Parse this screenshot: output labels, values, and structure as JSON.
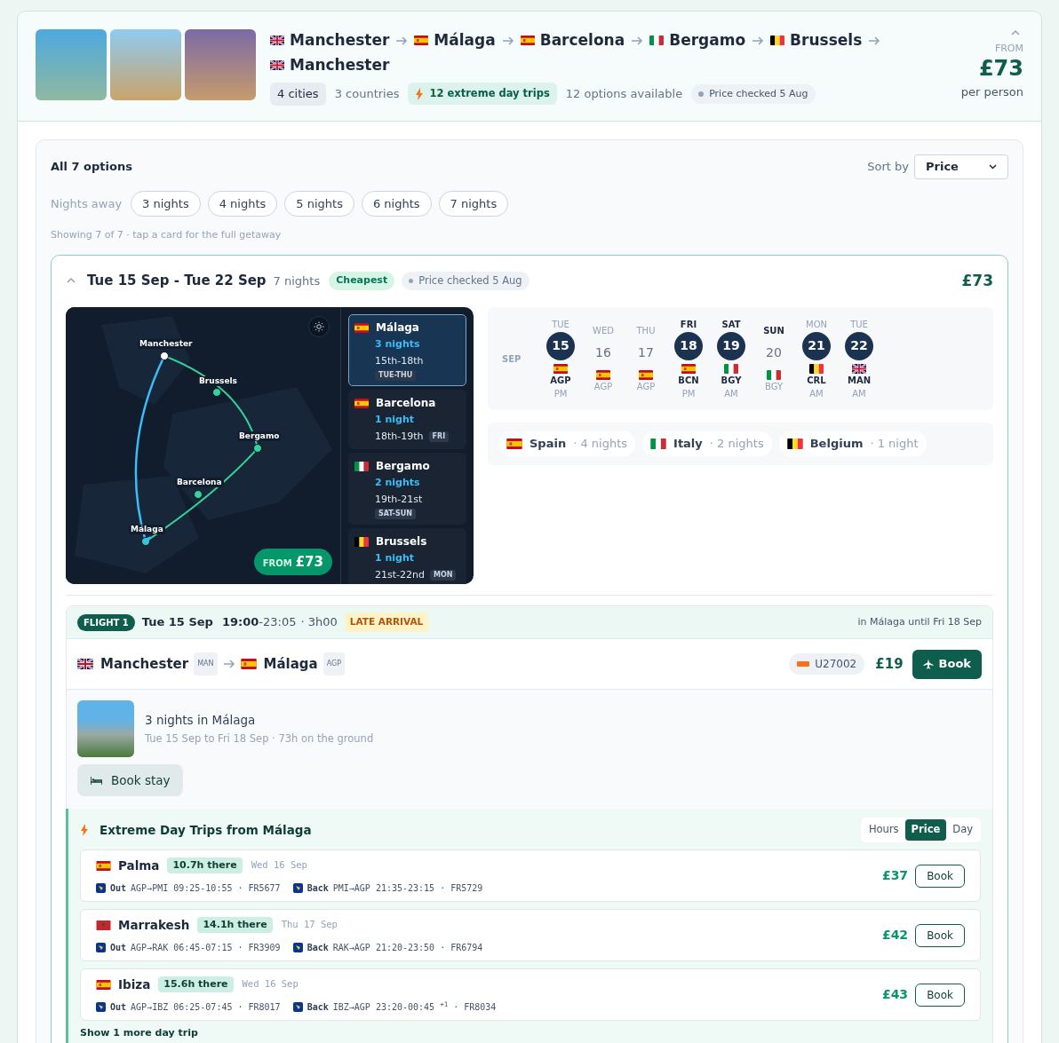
{
  "trip": {
    "route": [
      {
        "city": "Manchester",
        "kind": "gb"
      },
      {
        "city": "Málaga",
        "kind": "es"
      },
      {
        "city": "Barcelona",
        "kind": "es"
      },
      {
        "city": "Bergamo",
        "kind": "it"
      },
      {
        "city": "Brussels",
        "kind": "be"
      },
      {
        "city": "Manchester",
        "kind": "gb"
      }
    ],
    "cities": "4 cities",
    "countries": "3 countries",
    "day_trips": "12 extreme day trips",
    "options": "12 options available",
    "price_checked": "Price checked 5 Aug",
    "from_label": "FROM",
    "price": "£73",
    "per_person": "per person"
  },
  "panel": {
    "title": "All 7 options",
    "sort_label": "Sort by",
    "sort_value": "Price",
    "nights_label": "Nights away",
    "nights_filters": [
      {
        "label": "3 nights",
        "selected": false
      },
      {
        "label": "4 nights",
        "selected": false
      },
      {
        "label": "5 nights",
        "selected": false
      },
      {
        "label": "6 nights",
        "selected": false
      },
      {
        "label": "7 nights",
        "selected": false
      }
    ],
    "showing": "Showing 7 of 7 · tap a card for the full getaway"
  },
  "option": {
    "dates": "Tue 15 Sep - Tue 22 Sep",
    "nights": "7 nights",
    "badge": "Cheapest",
    "price_checked": "Price checked 5 Aug",
    "price": "£73",
    "map": {
      "labels": [
        "Manchester",
        "Brussels",
        "Bergamo",
        "Barcelona",
        "Málaga"
      ],
      "from_label": "FROM",
      "price": "£73"
    },
    "stops": [
      {
        "city": "Málaga",
        "kind": "es",
        "nights": "3 nights",
        "dates": "15th-18th",
        "days": "TUE-THU",
        "selected": true
      },
      {
        "city": "Barcelona",
        "kind": "es",
        "nights": "1 night",
        "dates": "18th-19th",
        "days": "FRI",
        "selected": false
      },
      {
        "city": "Bergamo",
        "kind": "it",
        "nights": "2 nights",
        "dates": "19th-21st",
        "days": "SAT-SUN",
        "selected": false
      },
      {
        "city": "Brussels",
        "kind": "be",
        "nights": "1 night",
        "dates": "21st-22nd",
        "days": "MON",
        "selected": false
      }
    ],
    "calendar": {
      "month": "SEP",
      "days": [
        {
          "dow": "TUE",
          "day": "15",
          "kind": "es",
          "code": "AGP",
          "time": "PM",
          "flight": true,
          "weekend": false
        },
        {
          "dow": "WED",
          "day": "16",
          "kind": "es",
          "code": "AGP",
          "flight": false,
          "weekend": false
        },
        {
          "dow": "THU",
          "day": "17",
          "kind": "es",
          "code": "AGP",
          "flight": false,
          "weekend": false
        },
        {
          "dow": "FRI",
          "day": "18",
          "kind": "es",
          "code": "BCN",
          "time": "PM",
          "flight": true,
          "weekend": true
        },
        {
          "dow": "SAT",
          "day": "19",
          "kind": "it",
          "code": "BGY",
          "time": "AM",
          "flight": true,
          "weekend": true
        },
        {
          "dow": "SUN",
          "day": "20",
          "kind": "it",
          "code": "BGY",
          "flight": false,
          "weekend": true
        },
        {
          "dow": "MON",
          "day": "21",
          "kind": "be",
          "code": "CRL",
          "time": "AM",
          "flight": true,
          "weekend": false
        },
        {
          "dow": "TUE",
          "day": "22",
          "kind": "gb",
          "code": "MAN",
          "time": "AM",
          "flight": true,
          "weekend": false
        }
      ]
    },
    "countries": [
      {
        "kind": "es",
        "name": "Spain",
        "nights": "· 4 nights"
      },
      {
        "kind": "it",
        "name": "Italy",
        "nights": "· 2 nights"
      },
      {
        "kind": "be",
        "name": "Belgium",
        "nights": "· 1 night"
      }
    ],
    "flight": {
      "label": "FLIGHT 1",
      "date": "Tue 15 Sep",
      "dep": "19:00",
      "arr": "-23:05",
      "duration": "· 3h00",
      "tag": "LATE ARRIVAL",
      "note": "in Málaga until Fri 18 Sep",
      "from": {
        "city": "Manchester",
        "kind": "gb",
        "code": "MAN"
      },
      "to": {
        "city": "Málaga",
        "kind": "es",
        "code": "AGP"
      },
      "flight_no": "U27002",
      "price": "£19",
      "book": "Book"
    },
    "stay": {
      "title": "3 nights in Málaga",
      "subtitle": "Tue 15 Sep to Fri 18 Sep · 73h on the ground",
      "button": "Book stay"
    },
    "day_trips": {
      "title": "Extreme Day Trips from Málaga",
      "sort": [
        {
          "label": "Hours",
          "selected": false
        },
        {
          "label": "Price",
          "selected": true
        },
        {
          "label": "Day",
          "selected": false
        }
      ],
      "trips": [
        {
          "kind": "es",
          "city": "Palma",
          "hours": "10.7h there",
          "date": "Wed 16 Sep",
          "out_label": "Out",
          "out": "AGP→PMI 09:25-10:55 · FR5677",
          "back_label": "Back",
          "back": "PMI→AGP 21:35-23:15 · FR5729",
          "price": "£37",
          "book": "Book"
        },
        {
          "kind": "ma",
          "city": "Marrakesh",
          "hours": "14.1h there",
          "date": "Thu 17 Sep",
          "out_label": "Out",
          "out": "AGP→RAK 06:45-07:15 · FR3909",
          "back_label": "Back",
          "back": "RAK→AGP 21:20-23:50 · FR6794",
          "price": "£42",
          "book": "Book"
        },
        {
          "kind": "es",
          "city": "Ibiza",
          "hours": "15.6h there",
          "date": "Wed 16 Sep",
          "out_label": "Out",
          "out": "AGP→IBZ 06:25-07:45 · FR8017",
          "back_label": "Back",
          "back": "IBZ→AGP 23:20-00:45 $^{+1}$ · FR8034",
          "price": "£43",
          "book": "Book"
        }
      ],
      "more": "Show 1 more day trip"
    }
  }
}
